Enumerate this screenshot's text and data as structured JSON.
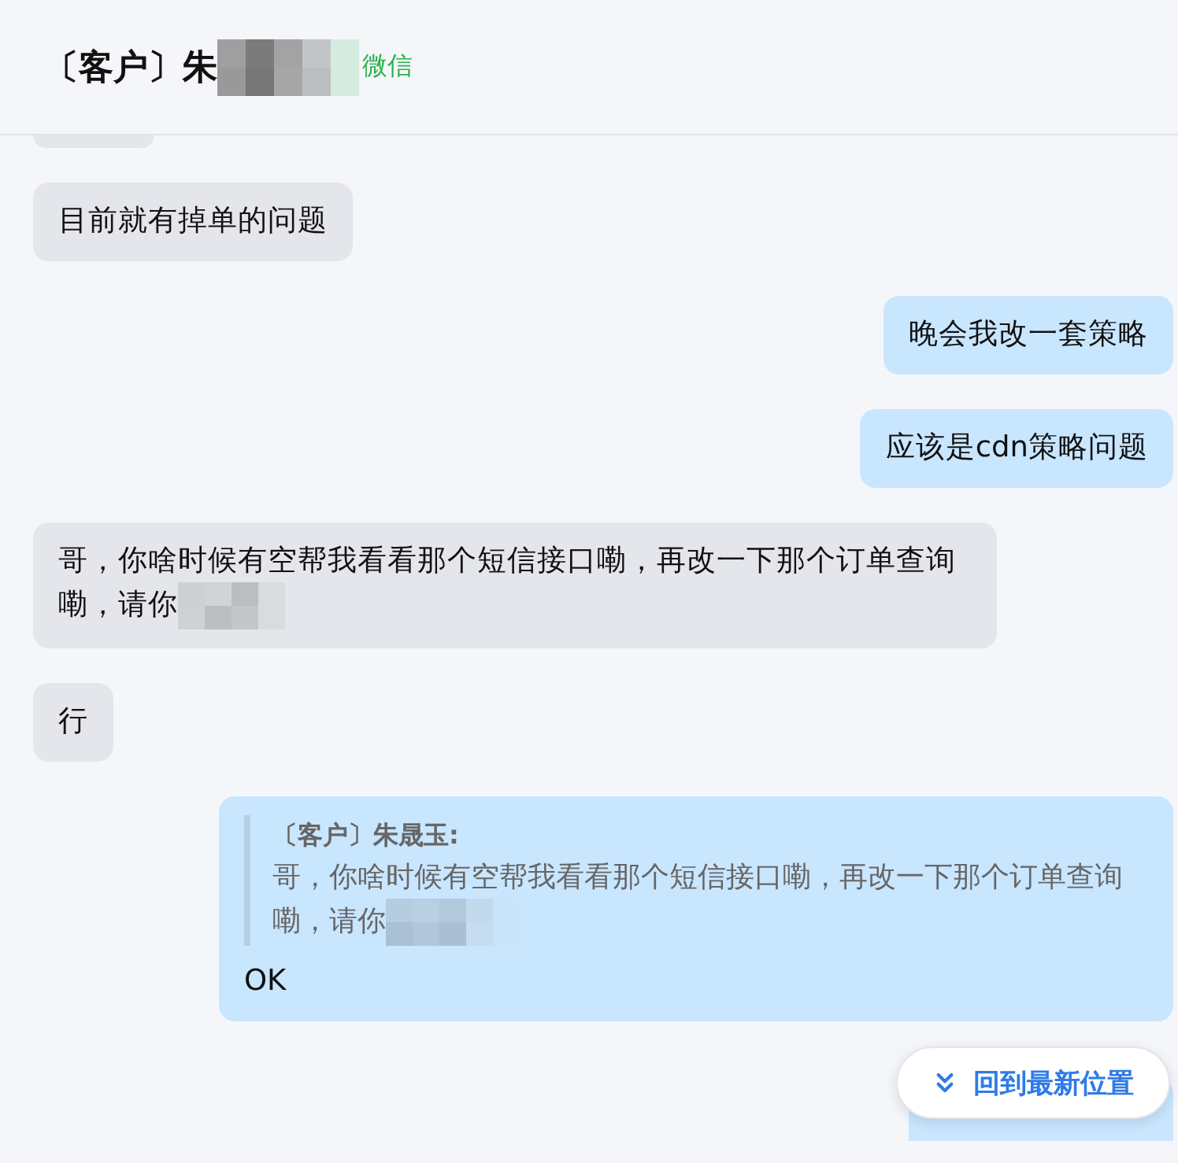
{
  "header": {
    "title": "〔客户〕朱",
    "redacted": true,
    "channel": "微信"
  },
  "messages": [
    {
      "outgoing": false,
      "kind": "clipped"
    },
    {
      "outgoing": false,
      "kind": "text",
      "text": "目前就有掉单的问题"
    },
    {
      "outgoing": true,
      "kind": "text",
      "text": "晚会我改一套策略"
    },
    {
      "outgoing": true,
      "kind": "text",
      "text": "应该是cdn策略问题"
    },
    {
      "outgoing": false,
      "kind": "text",
      "text": "哥，你啥时候有空帮我看看那个短信接口嘞，再改一下那个订单查询嘞，请你",
      "redacted": true
    },
    {
      "outgoing": false,
      "kind": "text",
      "text": "行"
    },
    {
      "outgoing": true,
      "kind": "reply",
      "quote": {
        "author": "〔客户〕朱晟玉:",
        "text": "哥，你啥时候有空帮我看看那个短信接口嘞，再改一下那个订单查询嘞，请你",
        "redacted": true
      },
      "text": "OK"
    },
    {
      "outgoing": true,
      "kind": "clipped"
    }
  ],
  "jump_button": {
    "label": "回到最新位置"
  }
}
